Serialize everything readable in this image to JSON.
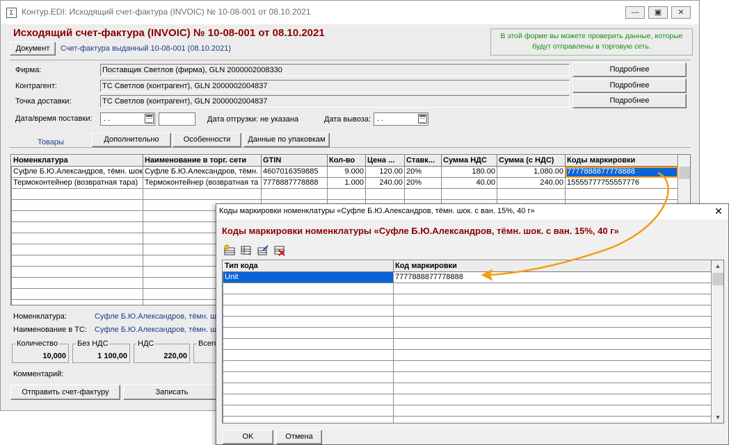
{
  "window": {
    "title": "Контур.EDI: Исходящий счет-фактура (INVOIC) № 10-08-001 от 08.10.2021",
    "title_icon": "Σ",
    "controls": [
      "minimize-icon",
      "restore-icon",
      "close-icon"
    ]
  },
  "header": {
    "title": "Исходящий счет-фактура (INVOIC) № 10-08-001 от 08.10.2021",
    "document_button": "Документ",
    "document_link": "Счет-фактура выданный 10-08-001 (08.10.2021)",
    "hint": "В этой форме вы можете проверить данные, которые будут отправлены в торговую сеть."
  },
  "fields": {
    "firm_label": "Фирма:",
    "firm_value": "Поставщик Светлов (фирма), GLN 2000002008330",
    "contractor_label": "Контрагент:",
    "contractor_value": "ТС Светлов (контрагент), GLN 2000002004837",
    "delivery_point_label": "Точка доставки:",
    "delivery_point_value": "ТС Светлов (контрагент), GLN 2000002004837",
    "details_button": "Подробнее",
    "delivery_datetime_label": "Дата/время поставки:",
    "delivery_date_value": " .  .",
    "shipment_date_text": "Дата отгрузки: не указана",
    "pickup_date_label": "Дата вывоза:",
    "pickup_date_value": " .  ."
  },
  "tabs": [
    "Товары",
    "Дополнительно",
    "Особенности",
    "Данные по упаковкам"
  ],
  "goods_table": {
    "columns": [
      "Номенклатура",
      "Наименование в торг. сети",
      "GTIN",
      "Кол-во",
      "Цена ...",
      "Ставк...",
      "Сумма НДС",
      "Сумма (с НДС)",
      "Коды маркировки"
    ],
    "rows": [
      [
        "Суфле Б.Ю.Александров, тёмн. шок",
        "Суфле Б.Ю.Александров, тёмн. ш",
        "4607016359885",
        "9.000",
        "120.00",
        "20%",
        "180.00",
        "1,080.00",
        "7777888877778888"
      ],
      [
        "Термоконтейнер (возвратная тара)",
        "Термоконтейнер (возвратная та",
        "7778887778888",
        "1.000",
        "240.00",
        "20%",
        "40.00",
        "240.00",
        "15555777755557776"
      ]
    ]
  },
  "details": {
    "nomenclature_label": "Номенклатура:",
    "nomenclature_value": "Суфле Б.Ю.Александров, тёмн. шок",
    "name_in_ts_label": "Наименование в ТС:",
    "name_in_ts_value": "Суфле Б.Ю.Александров, тёмн. шок"
  },
  "totals": {
    "quantity_label": "Количество",
    "quantity_value": "10,000",
    "without_vat_label": "Без НДС",
    "without_vat_value": "1 100,00",
    "vat_label": "НДС",
    "vat_value": "220,00",
    "total_label": "Всего"
  },
  "comment_label": "Комментарий:",
  "actions": {
    "send_button": "Отправить счет-фактуру",
    "save_button": "Записать"
  },
  "dialog": {
    "window_title": "Коды маркировки номенклатуры «Суфле Б.Ю.Александров, тёмн. шок. с ван. 15%, 40 г»",
    "heading": "Коды маркировки номенклатуры «Суфле Б.Ю.Александров, тёмн. шок. с ван. 15%, 40 г»",
    "toolbar_icons": [
      "add-row-icon",
      "insert-row-icon",
      "edit-row-icon",
      "delete-row-icon"
    ],
    "columns": [
      "Тип кода",
      "Код маркировки"
    ],
    "rows": [
      [
        "Unit",
        "7777888877778888"
      ]
    ],
    "ok_button": "OK",
    "cancel_button": "Отмена",
    "close_glyph": "✕"
  },
  "colors": {
    "header_red": "#8b0000",
    "link_blue": "#1f3a8f",
    "hint_green": "#138f13",
    "selection_blue": "#0a64d8",
    "highlight_orange": "#f39c12"
  }
}
